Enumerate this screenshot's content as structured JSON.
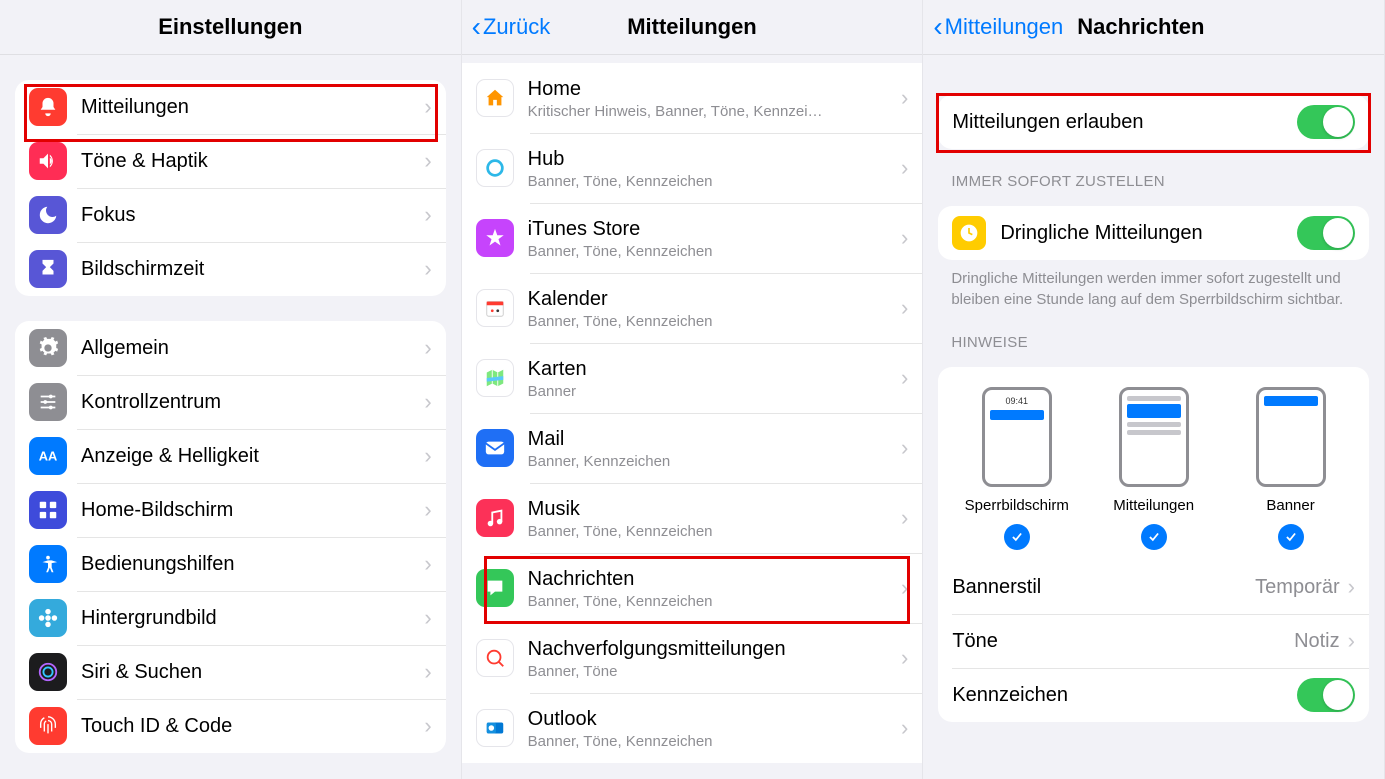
{
  "panel1": {
    "title": "Einstellungen",
    "group1": [
      {
        "name": "mitteilungen",
        "label": "Mitteilungen",
        "color": "#ff3b30",
        "icon": "bell"
      },
      {
        "name": "toene",
        "label": "Töne & Haptik",
        "color": "#ff2d55",
        "icon": "speaker"
      },
      {
        "name": "fokus",
        "label": "Fokus",
        "color": "#5856d6",
        "icon": "moon"
      },
      {
        "name": "bildschirmzeit",
        "label": "Bildschirmzeit",
        "color": "#5856d6",
        "icon": "hourglass"
      }
    ],
    "group2": [
      {
        "name": "allgemein",
        "label": "Allgemein",
        "color": "#8e8e93",
        "icon": "gear"
      },
      {
        "name": "kontrollzentrum",
        "label": "Kontrollzentrum",
        "color": "#8e8e93",
        "icon": "sliders"
      },
      {
        "name": "anzeige",
        "label": "Anzeige & Helligkeit",
        "color": "#007aff",
        "icon": "aa"
      },
      {
        "name": "home-bildschirm",
        "label": "Home-Bildschirm",
        "color": "#3e4bdb",
        "icon": "grid"
      },
      {
        "name": "bedienungshilfen",
        "label": "Bedienungshilfen",
        "color": "#007aff",
        "icon": "access"
      },
      {
        "name": "hintergrundbild",
        "label": "Hintergrundbild",
        "color": "#34aadc",
        "icon": "flower"
      },
      {
        "name": "siri",
        "label": "Siri & Suchen",
        "color": "#1c1c1e",
        "icon": "siri"
      },
      {
        "name": "touchid",
        "label": "Touch ID & Code",
        "color": "#ff3b30",
        "icon": "fingerprint"
      }
    ]
  },
  "panel2": {
    "back": "Zurück",
    "title": "Mitteilungen",
    "apps": [
      {
        "name": "home",
        "label": "Home",
        "sub": "Kritischer Hinweis, Banner, Töne, Kennzei…",
        "color": "#fff",
        "icon": "home"
      },
      {
        "name": "hub",
        "label": "Hub",
        "sub": "Banner, Töne, Kennzeichen",
        "color": "#fff",
        "icon": "hub"
      },
      {
        "name": "itunes",
        "label": "iTunes Store",
        "sub": "Banner, Töne, Kennzeichen",
        "color": "#c644fc",
        "icon": "star"
      },
      {
        "name": "kalender",
        "label": "Kalender",
        "sub": "Banner, Töne, Kennzeichen",
        "color": "#fff",
        "icon": "calendar"
      },
      {
        "name": "karten",
        "label": "Karten",
        "sub": "Banner",
        "color": "#fff",
        "icon": "maps"
      },
      {
        "name": "mail",
        "label": "Mail",
        "sub": "Banner, Kennzeichen",
        "color": "#1f6ff5",
        "icon": "mail"
      },
      {
        "name": "musik",
        "label": "Musik",
        "sub": "Banner, Töne, Kennzeichen",
        "color": "#fc3158",
        "icon": "music"
      },
      {
        "name": "nachrichten",
        "label": "Nachrichten",
        "sub": "Banner, Töne, Kennzeichen",
        "color": "#34c759",
        "icon": "message"
      },
      {
        "name": "nachverfolgung",
        "label": "Nachverfolgungsmitteilungen",
        "sub": "Banner, Töne",
        "color": "#fff",
        "icon": "tracking"
      },
      {
        "name": "outlook",
        "label": "Outlook",
        "sub": "Banner, Töne, Kennzeichen",
        "color": "#fff",
        "icon": "outlook"
      }
    ]
  },
  "panel3": {
    "back": "Mitteilungen",
    "title": "Nachrichten",
    "allow_label": "Mitteilungen erlauben",
    "section_immediate": "IMMER SOFORT ZUSTELLEN",
    "urgent_label": "Dringliche Mitteilungen",
    "urgent_footer": "Dringliche Mitteilungen werden immer sofort zugestellt und bleiben eine Stunde lang auf dem Sperrbildschirm sichtbar.",
    "section_alerts": "HINWEISE",
    "alert_time": "09:41",
    "alert_types": [
      {
        "name": "sperrbildschirm",
        "label": "Sperrbildschirm"
      },
      {
        "name": "mitteilungen",
        "label": "Mitteilungen"
      },
      {
        "name": "banner",
        "label": "Banner"
      }
    ],
    "rows": [
      {
        "name": "bannerstil",
        "label": "Bannerstil",
        "value": "Temporär",
        "type": "link"
      },
      {
        "name": "toene",
        "label": "Töne",
        "value": "Notiz",
        "type": "link"
      },
      {
        "name": "kennzeichen",
        "label": "Kennzeichen",
        "type": "toggle"
      }
    ]
  }
}
